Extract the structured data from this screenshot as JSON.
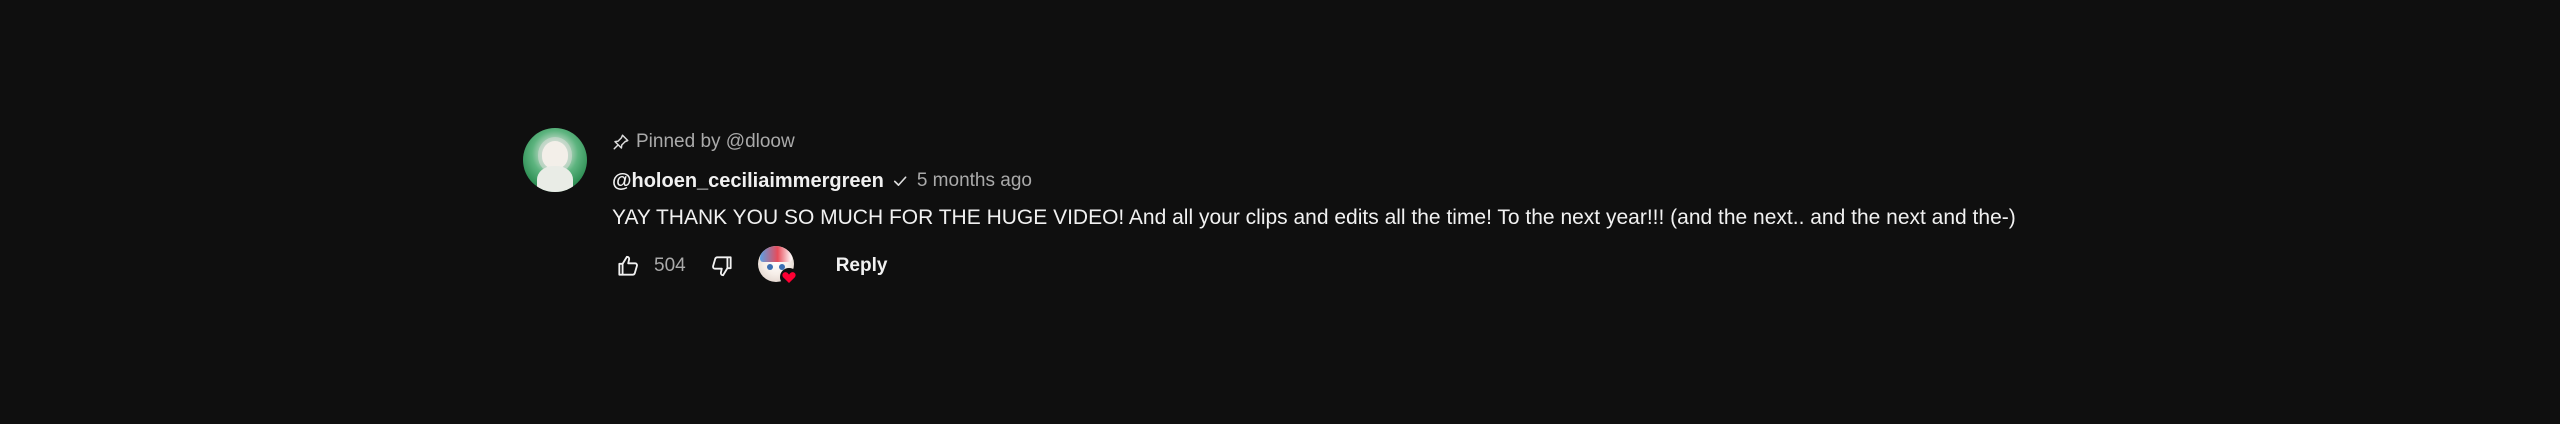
{
  "comment": {
    "pinned_label": "Pinned by @dloow",
    "author": "@holoen_ceciliaimmergreen",
    "timestamp": "5 months ago",
    "text": "YAY THANK YOU SO MUCH FOR THE HUGE VIDEO! And all your clips and edits all the time! To the next year!!! (and the next.. and the next and the-)",
    "like_count": "504",
    "reply_label": "Reply"
  },
  "icons": {
    "pin": "pin-icon",
    "verified": "check-icon",
    "like": "thumbs-up-icon",
    "dislike": "thumbs-down-icon",
    "creator_heart": "heart-icon"
  },
  "colors": {
    "background": "#0f0f0f",
    "primary_text": "#f1f1f1",
    "secondary_text": "#aaaaaa",
    "heart": "#ff0033"
  }
}
